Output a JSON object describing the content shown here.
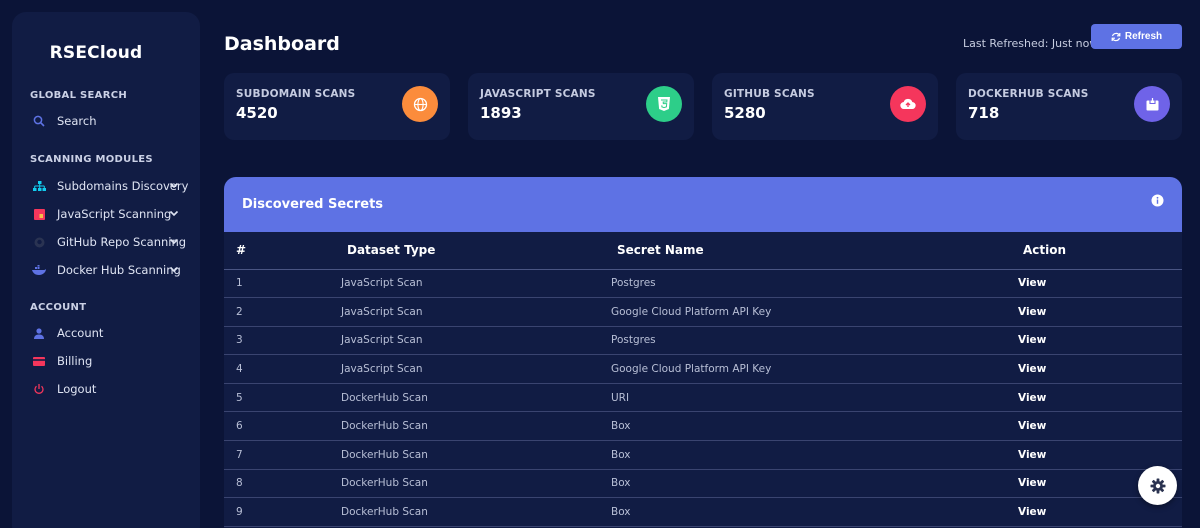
{
  "app": {
    "name": "RSECloud"
  },
  "sidebar": {
    "sections": [
      {
        "title": "GLOBAL SEARCH",
        "items": [
          {
            "label": "Search",
            "icon": "search-icon",
            "color": "#5e72e4"
          }
        ]
      },
      {
        "title": "SCANNING MODULES",
        "items": [
          {
            "label": "Subdomains Discovery",
            "icon": "sitemap-icon",
            "color": "#11cdef"
          },
          {
            "label": "JavaScript Scanning",
            "icon": "javascript-icon",
            "color": "#f5365c"
          },
          {
            "label": "GitHub Repo Scanning",
            "icon": "github-icon",
            "color": "#2a3352"
          },
          {
            "label": "Docker Hub Scanning",
            "icon": "docker-icon",
            "color": "#5e72e4"
          }
        ]
      },
      {
        "title": "ACCOUNT",
        "items": [
          {
            "label": "Account",
            "icon": "user-icon",
            "color": "#5e72e4"
          },
          {
            "label": "Billing",
            "icon": "credit-card-icon",
            "color": "#f5365c"
          },
          {
            "label": "Logout",
            "icon": "power-icon",
            "color": "#f5365c"
          }
        ]
      }
    ]
  },
  "header": {
    "title": "Dashboard",
    "last_refreshed": "Last Refreshed: Just now",
    "refresh_label": "Refresh"
  },
  "stats": [
    {
      "label": "SUBDOMAIN SCANS",
      "value": "4520",
      "icon": "globe-icon",
      "color": "#fb8c3c"
    },
    {
      "label": "JAVASCRIPT SCANS",
      "value": "1893",
      "icon": "html5-icon",
      "color": "#2dce89"
    },
    {
      "label": "GITHUB SCANS",
      "value": "5280",
      "icon": "cloud-upload-icon",
      "color": "#f5365c"
    },
    {
      "label": "DOCKERHUB SCANS",
      "value": "718",
      "icon": "box-icon",
      "color": "#6f63e8"
    }
  ],
  "secrets": {
    "title": "Discovered Secrets",
    "columns": [
      "#",
      "Dataset Type",
      "Secret Name",
      "Action"
    ],
    "rows": [
      [
        "1",
        "JavaScript Scan",
        "Postgres",
        "View"
      ],
      [
        "2",
        "JavaScript Scan",
        "Google Cloud Platform API Key",
        "View"
      ],
      [
        "3",
        "JavaScript Scan",
        "Postgres",
        "View"
      ],
      [
        "4",
        "JavaScript Scan",
        "Google Cloud Platform API Key",
        "View"
      ],
      [
        "5",
        "DockerHub Scan",
        "URI",
        "View"
      ],
      [
        "6",
        "DockerHub Scan",
        "Box",
        "View"
      ],
      [
        "7",
        "DockerHub Scan",
        "Box",
        "View"
      ],
      [
        "8",
        "DockerHub Scan",
        "Box",
        "View"
      ],
      [
        "9",
        "DockerHub Scan",
        "Box",
        "View"
      ]
    ]
  }
}
